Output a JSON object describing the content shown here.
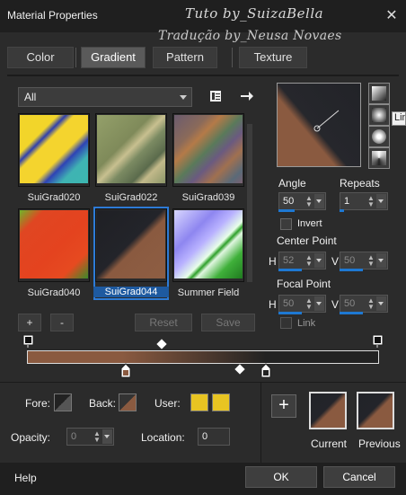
{
  "window": {
    "title": "Material Properties",
    "close_glyph": "✕",
    "watermark_line1": "Tuto by_SuizaBella",
    "watermark_line2": "Tradução by_Neusa Novaes"
  },
  "tabs": [
    {
      "label": "Color",
      "active": false
    },
    {
      "label": "Gradient",
      "active": true
    },
    {
      "label": "Pattern",
      "active": false
    },
    {
      "label": "Texture",
      "active": false
    }
  ],
  "library": {
    "category_value": "All",
    "selected": "SuiGrad044",
    "items": [
      {
        "label": "SuiGrad020"
      },
      {
        "label": "SuiGrad022"
      },
      {
        "label": "SuiGrad039"
      },
      {
        "label": "SuiGrad040"
      },
      {
        "label": "SuiGrad044"
      },
      {
        "label": "Summer Field"
      }
    ],
    "add_label": "+",
    "remove_label": "-",
    "reset_label": "Reset",
    "save_label": "Save"
  },
  "style_tooltip": "Lin",
  "settings": {
    "angle_label": "Angle",
    "angle_value": "50",
    "repeats_label": "Repeats",
    "repeats_value": "1",
    "invert_label": "Invert",
    "invert_checked": false,
    "center_label": "Center Point",
    "center_h_label": "H",
    "center_h": "52",
    "center_v_label": "V",
    "center_v": "50",
    "focal_label": "Focal Point",
    "focal_h_label": "H",
    "focal_h": "50",
    "focal_v_label": "V",
    "focal_v": "50",
    "link_label": "Link",
    "link_checked": false
  },
  "gradient_colors": {
    "start": "#8a5a40",
    "end": "#222222"
  },
  "stops": {
    "fore_label": "Fore:",
    "back_label": "Back:",
    "user_label": "User:",
    "user_color": "#e8c422",
    "opacity_label": "Opacity:",
    "opacity_value": "0",
    "location_label": "Location:",
    "location_value": "0"
  },
  "swatches": {
    "add_glyph": "+",
    "current_label": "Current",
    "previous_label": "Previous"
  },
  "footer": {
    "help_label": "Help",
    "ok_label": "OK",
    "cancel_label": "Cancel"
  }
}
